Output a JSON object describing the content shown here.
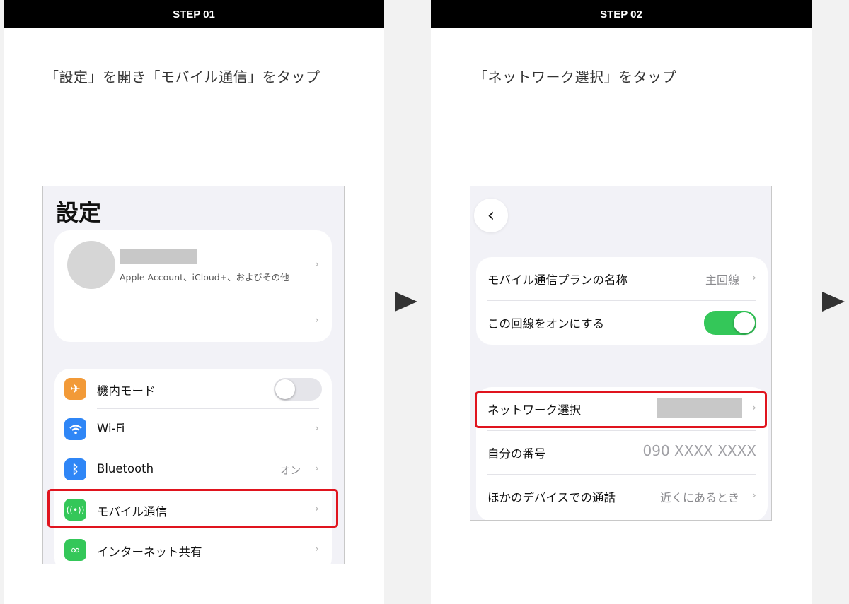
{
  "step1": {
    "header": "STEP 01",
    "instruction": "「設定」を開き「モバイル通信」をタップ",
    "screen": {
      "title": "設定",
      "account_subtitle": "Apple Account、iCloud+、およびその他",
      "rows": [
        {
          "label": "機内モード",
          "icon": "airplane-icon",
          "color": "#f29a38",
          "toggle": false
        },
        {
          "label": "Wi-Fi",
          "icon": "wifi-icon",
          "color": "#2f86f6"
        },
        {
          "label": "Bluetooth",
          "icon": "bluetooth-icon",
          "color": "#2f86f6",
          "value": "オン"
        },
        {
          "label": "モバイル通信",
          "icon": "antenna-icon",
          "color": "#34c759"
        },
        {
          "label": "インターネット共有",
          "icon": "link-icon",
          "color": "#34c759"
        }
      ]
    }
  },
  "step2": {
    "header": "STEP 02",
    "instruction": "「ネットワーク選択」をタップ",
    "screen": {
      "plan_rows": [
        {
          "label": "モバイル通信プランの名称",
          "value": "主回線"
        },
        {
          "label": "この回線をオンにする",
          "toggle": true
        }
      ],
      "network_rows": [
        {
          "label": "ネットワーク選択"
        },
        {
          "label": "自分の番号",
          "value": "090 XXXX XXXX"
        },
        {
          "label": "ほかのデバイスでの通話",
          "value": "近くにあるとき"
        }
      ]
    }
  },
  "colors": {
    "highlight": "#e0141e",
    "toggle_on": "#34c759",
    "toggle_off": "#e5e5ea"
  }
}
